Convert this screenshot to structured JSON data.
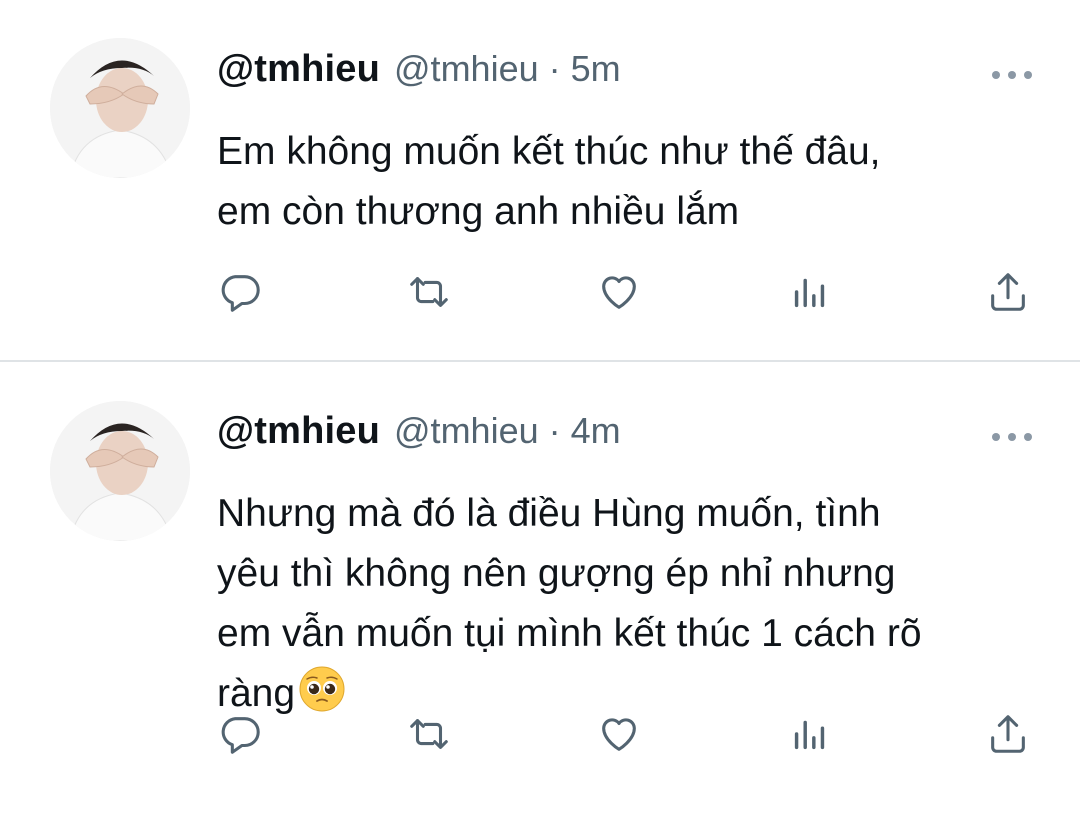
{
  "tweets": [
    {
      "display_name": "@tmhieu",
      "handle": "@tmhieu",
      "separator": "·",
      "time": "5m",
      "text": "Em không muốn kết thúc như thế đâu,\nem còn thương anh nhiều lắm",
      "emoji": "",
      "actions": [
        "reply-icon",
        "retweet-icon",
        "like-icon",
        "analytics-icon",
        "share-icon"
      ]
    },
    {
      "display_name": "@tmhieu",
      "handle": "@tmhieu",
      "separator": "·",
      "time": "4m",
      "text": "Nhưng mà đó là điều Hùng muốn, tình\nyêu thì không nên gượng ép nhỉ nhưng\nem vẫn muốn tụi mình kết thúc 1 cách rõ\nràng",
      "emoji": "pleading-face-emoji",
      "actions": [
        "reply-icon",
        "retweet-icon",
        "like-icon",
        "analytics-icon",
        "share-icon"
      ]
    }
  ],
  "colors": {
    "text": "#0f1419",
    "secondary": "#536471",
    "divider": "#dfe3e6",
    "icon": "#536471"
  }
}
